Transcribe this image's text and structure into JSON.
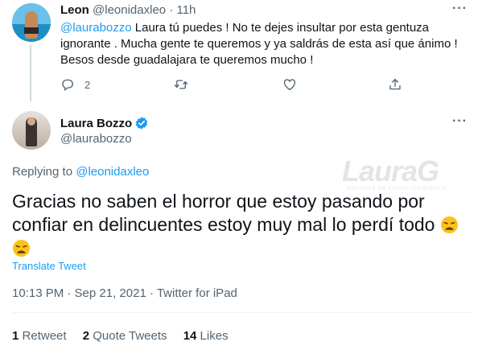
{
  "reply_tweet": {
    "author_name": "Leon",
    "author_handle": "@leonidaxleo",
    "separator": "·",
    "time_ago": "11h",
    "mention": "@laurabozzo",
    "text": " Laura tú puedes ! No te dejes insultar por esta gentuza ignorante . Mucha gente te queremos y ya saldrás de esta así que ánimo ! Besos desde guadalajara te queremos mucho !",
    "reply_count": "2",
    "more_label": "···"
  },
  "main_tweet": {
    "author_name": "Laura Bozzo",
    "author_handle": "@laurabozzo",
    "verified": true,
    "replying_to_label": "Replying to ",
    "replying_to_handle": "@leonidaxleo",
    "text": "Gracias no saben el horror que estoy pasando por confiar en delincuentes estoy muy mal lo perdí todo",
    "translate_label": "Translate Tweet",
    "timestamp": "10:13 PM · Sep 21, 2021 · Twitter for iPad",
    "more_label": "···",
    "watermark": "LauraG",
    "watermark_sub": "NOTICIAS DE ENTRETENIMIENTO"
  },
  "stats": {
    "retweets_count": "1",
    "retweets_label": "Retweet",
    "quotes_count": "2",
    "quotes_label": "Quote Tweets",
    "likes_count": "14",
    "likes_label": "Likes"
  },
  "colors": {
    "accent": "#1d9bf0",
    "muted": "#536471",
    "text": "#0f1419",
    "divider": "#eff3f4"
  },
  "icons": [
    "reply-icon",
    "retweet-icon",
    "like-icon",
    "share-icon",
    "verified-badge-icon",
    "weary-face-emoji"
  ]
}
